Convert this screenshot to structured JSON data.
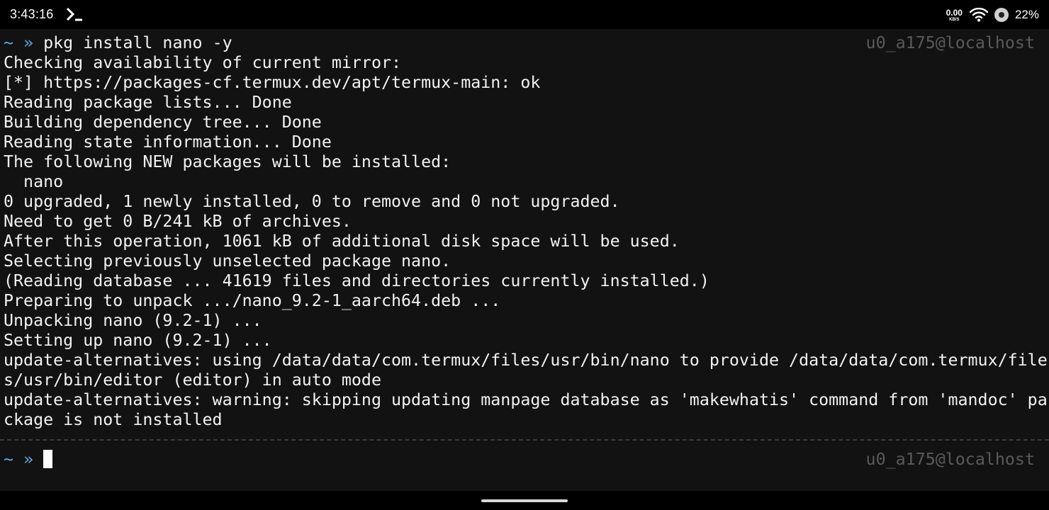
{
  "status_bar": {
    "time": "3:43:16",
    "app_icon": "terminal-icon",
    "net_speed_value": "0.00",
    "net_speed_unit": "KB/S",
    "wifi_icon": "wifi-icon",
    "indicator_icon": "circle-indicator-icon",
    "battery": "22%"
  },
  "terminal": {
    "prompt_symbol": "~",
    "prompt_arrow": "»",
    "hostname": "u0_a175@localhost",
    "command": "pkg install nano -y",
    "output_lines": [
      "Checking availability of current mirror:",
      "[*] https://packages-cf.termux.dev/apt/termux-main: ok",
      "Reading package lists... Done",
      "Building dependency tree... Done",
      "Reading state information... Done",
      "The following NEW packages will be installed:",
      "  nano",
      "0 upgraded, 1 newly installed, 0 to remove and 0 not upgraded.",
      "Need to get 0 B/241 kB of archives.",
      "After this operation, 1061 kB of additional disk space will be used.",
      "Selecting previously unselected package nano.",
      "(Reading database ... 41619 files and directories currently installed.)",
      "Preparing to unpack .../nano_9.2-1_aarch64.deb ...",
      "Unpacking nano (9.2-1) ...",
      "Setting up nano (9.2-1) ...",
      "update-alternatives: using /data/data/com.termux/files/usr/bin/nano to provide /data/data/com.termux/file",
      "s/usr/bin/editor (editor) in auto mode",
      "update-alternatives: warning: skipping updating manpage database as 'makewhatis' command from 'mandoc' pa",
      "ckage is not installed"
    ]
  },
  "colors": {
    "background": "#121212",
    "text": "#f2f2f2",
    "prompt": "#5fa8e6",
    "hostname": "#5a5a5a"
  }
}
